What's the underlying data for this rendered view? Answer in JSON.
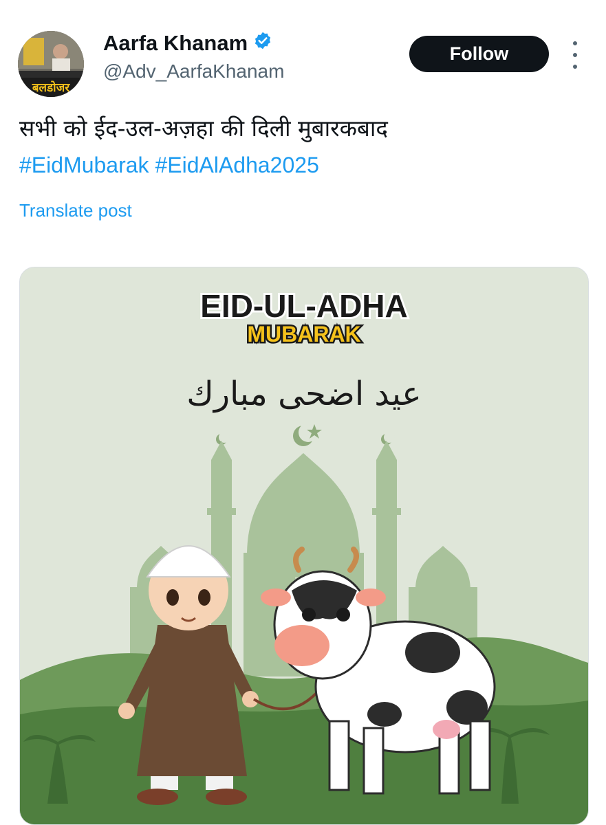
{
  "author": {
    "name": "Aarfa Khanam",
    "handle": "@Adv_AarfaKhanam",
    "verified": true,
    "avatar_banner_text": "बलडोजर"
  },
  "actions": {
    "follow_label": "Follow",
    "more_icon": "more-vertical-icon"
  },
  "post": {
    "text": "सभी को ईद-उल-अज़हा की दिली मुबारकबाद",
    "hashtags": [
      "#EidMubarak",
      "#EidAlAdha2025"
    ],
    "translate_label": "Translate post"
  },
  "media": {
    "title": "EID-UL-ADHA",
    "subtitle": "MUBARAK",
    "arabic": "عيد اضحى مبارك"
  },
  "colors": {
    "link": "#1d9bf0",
    "verified": "#1d9bf0",
    "follow_bg": "#0f1419",
    "subtitle_yellow": "#f5c21b",
    "media_bg": "#dfe6d9"
  }
}
